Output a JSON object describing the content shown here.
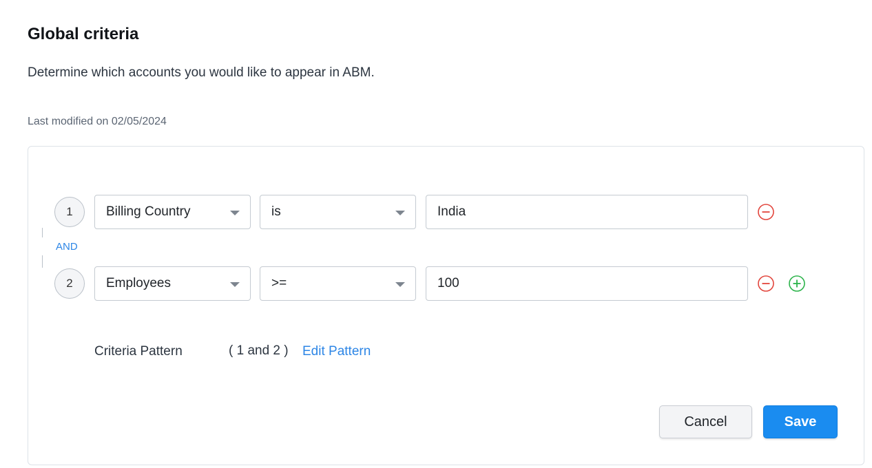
{
  "header": {
    "title": "Global criteria",
    "subtitle": "Determine which accounts you would like to appear in ABM.",
    "last_modified": "Last modified on 02/05/2024"
  },
  "criteria": [
    {
      "number": "1",
      "field": "Billing Country",
      "operator": "is",
      "value": "India"
    },
    {
      "number": "2",
      "field": "Employees",
      "operator": ">=",
      "value": "100"
    }
  ],
  "connector": "AND",
  "pattern": {
    "label": "Criteria Pattern",
    "value": "( 1 and 2 )",
    "edit_label": "Edit Pattern"
  },
  "actions": {
    "cancel_label": "Cancel",
    "save_label": "Save"
  },
  "icons": {
    "remove": "minus-circle-icon",
    "add": "plus-circle-icon",
    "dropdown": "caret-down-icon"
  },
  "colors": {
    "accent": "#1a8cf0",
    "link": "#2d86e6",
    "remove": "#e2453c",
    "add": "#2bb34a"
  }
}
